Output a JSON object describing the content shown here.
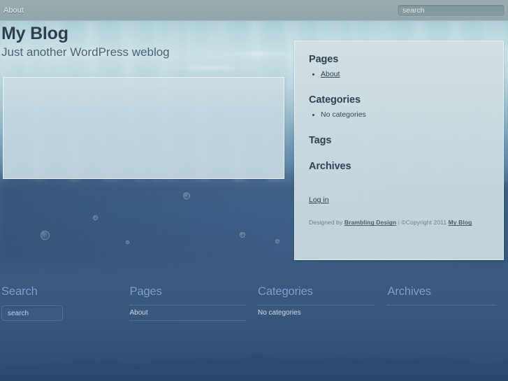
{
  "topbar": {
    "nav_items": [
      {
        "label": "About"
      }
    ],
    "search_placeholder": "search"
  },
  "header": {
    "site_title": "My Blog",
    "site_description": "Just another WordPress weblog"
  },
  "content": {
    "posts": []
  },
  "sidebar": {
    "widgets": [
      {
        "title": "Pages",
        "items": [
          {
            "label": "About",
            "is_link": true
          }
        ]
      },
      {
        "title": "Categories",
        "items": [
          {
            "label": "No categories",
            "is_link": false
          }
        ]
      },
      {
        "title": "Tags",
        "items": []
      },
      {
        "title": "Archives",
        "items": []
      }
    ],
    "meta": {
      "login_label": "Log in"
    },
    "credits": {
      "designed_by_prefix": "Designed by ",
      "designer_name": "Brambling Design",
      "separator": " | ",
      "copyright_text": "©Copyright 2011 ",
      "site_name": "My Blog"
    }
  },
  "footer": {
    "columns": [
      {
        "title": "Search",
        "type": "search",
        "search_placeholder": "search",
        "items": []
      },
      {
        "title": "Pages",
        "type": "list",
        "items": [
          {
            "label": "About",
            "is_link": true
          }
        ]
      },
      {
        "title": "Categories",
        "type": "list",
        "items": [
          {
            "label": "No categories",
            "is_link": false
          }
        ]
      },
      {
        "title": "Archives",
        "type": "list",
        "items": []
      }
    ]
  },
  "theme": {
    "accent_color": "#7fa5d6",
    "deep_water_color": "#3b5a7e",
    "panel_color": "#ccdde2",
    "heading_color": "#2f4050"
  }
}
